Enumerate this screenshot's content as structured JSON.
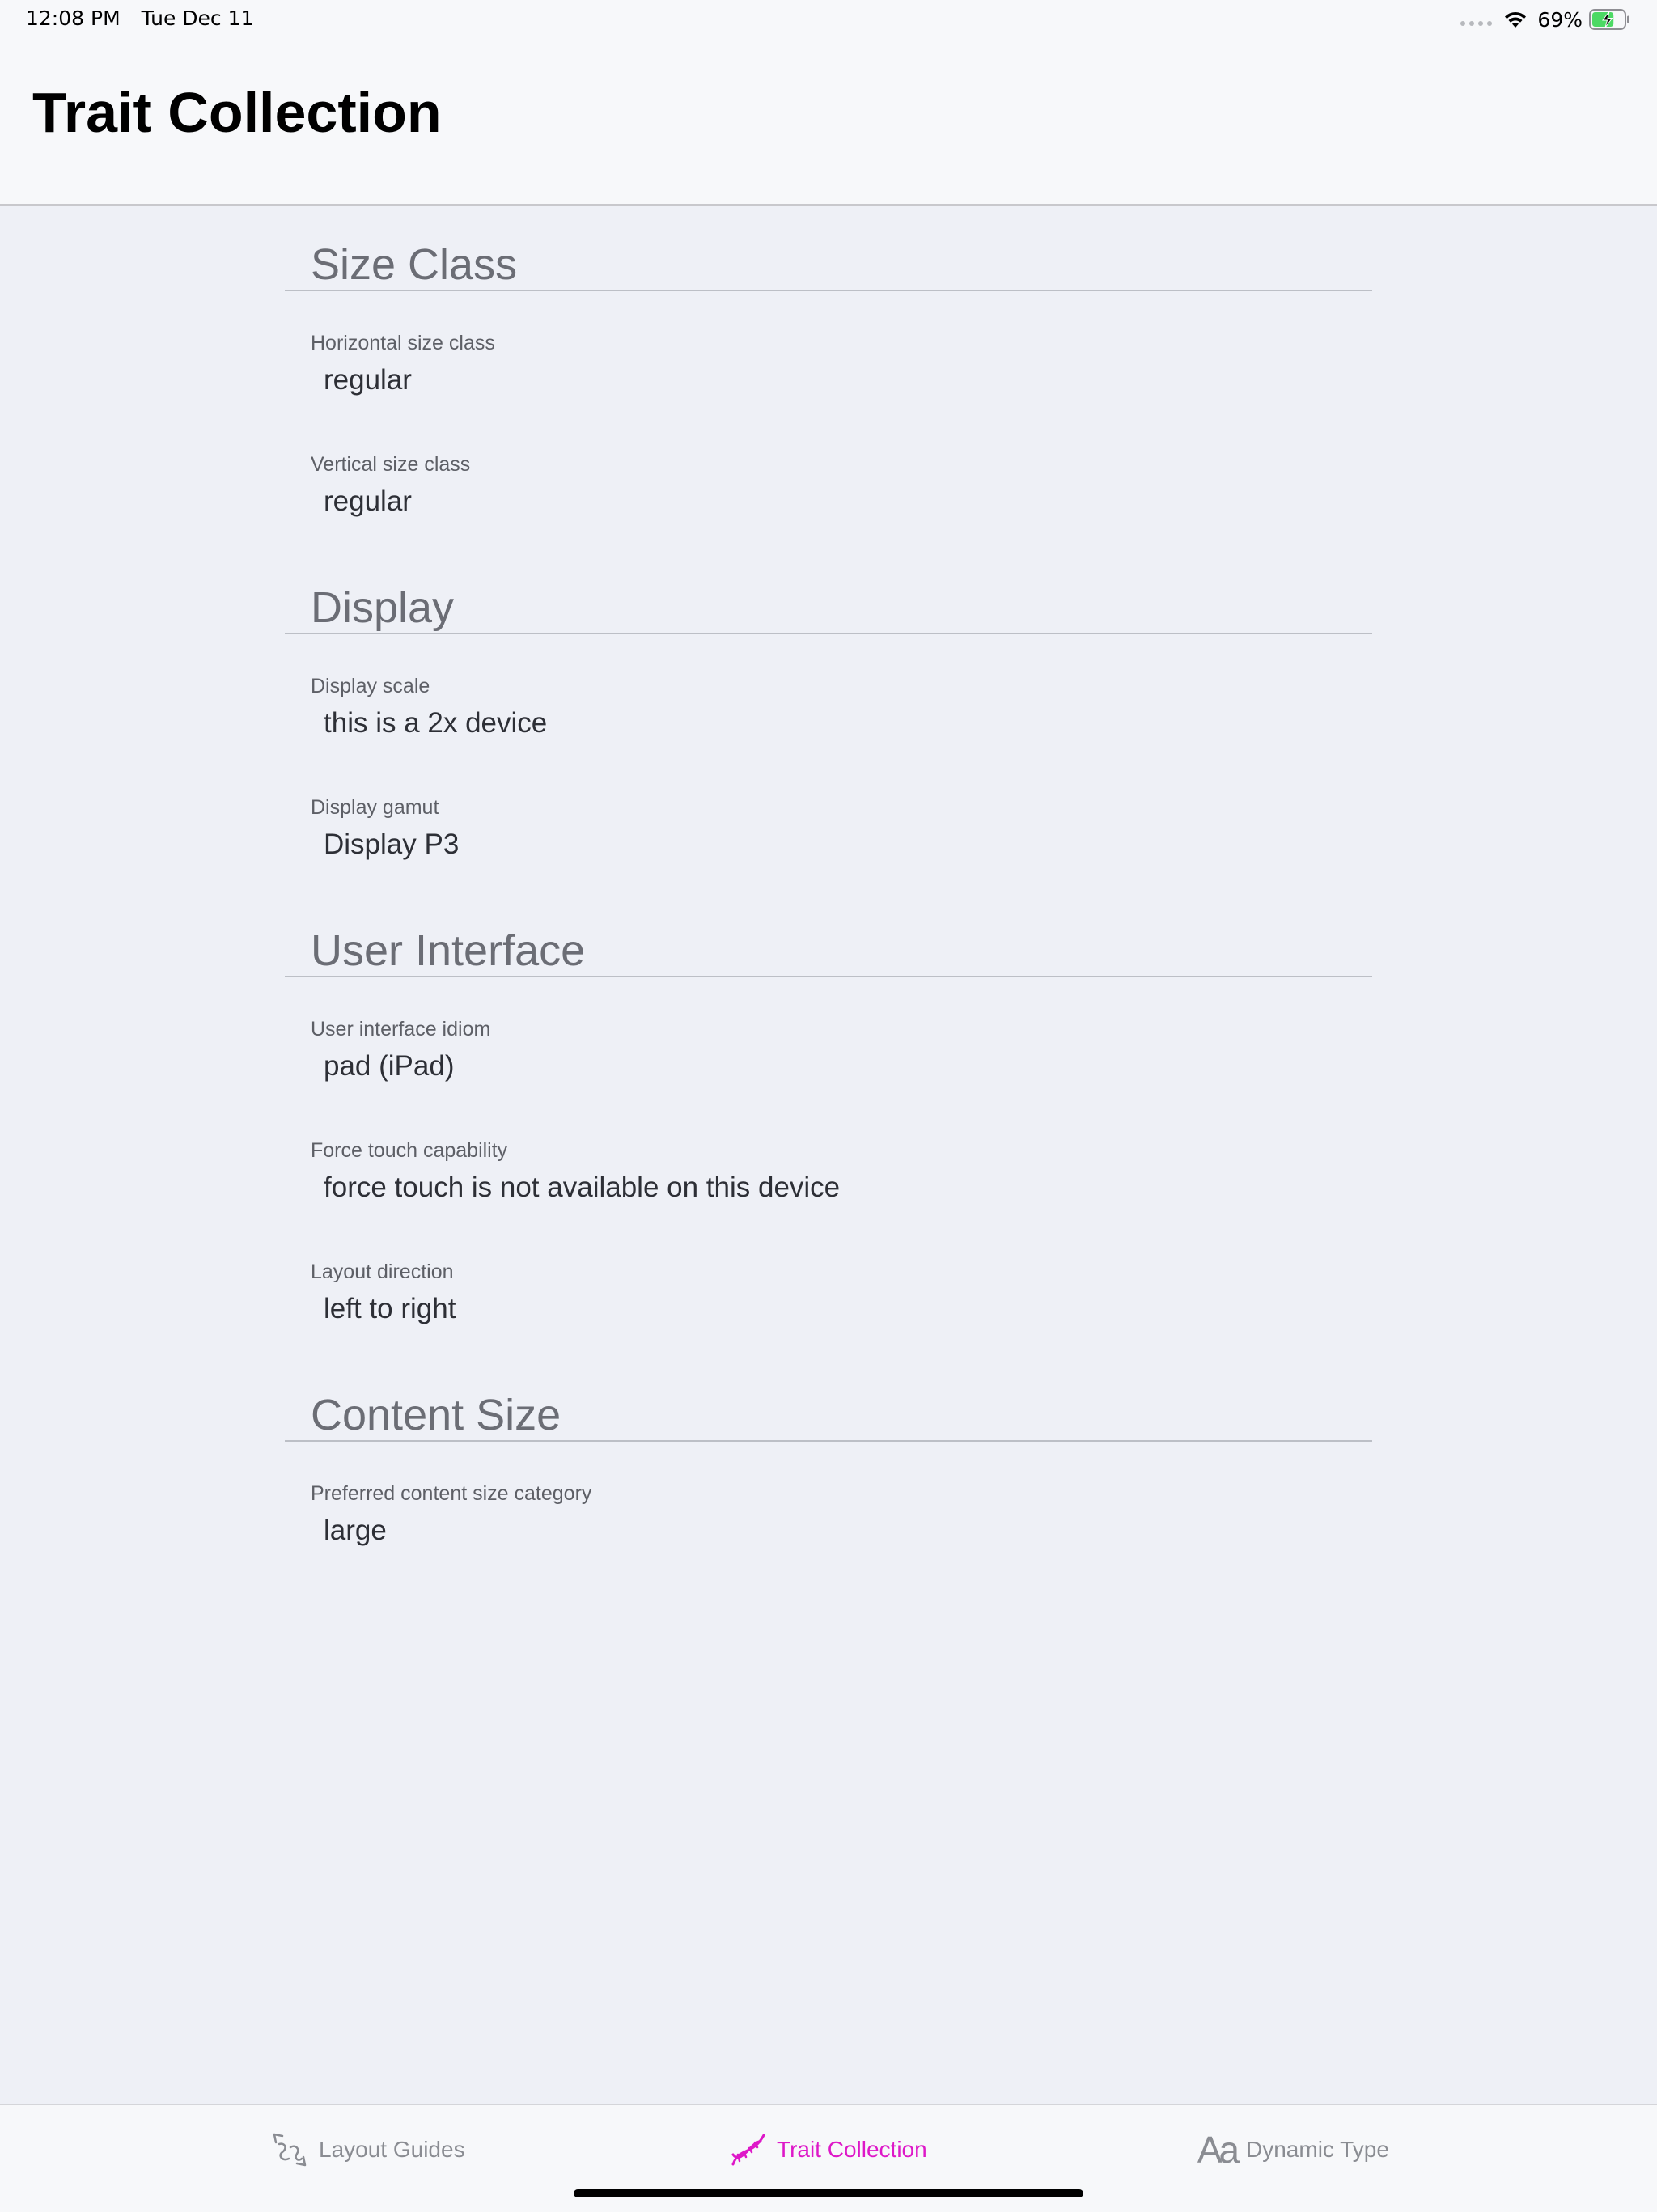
{
  "status_bar": {
    "time": "12:08 PM",
    "date": "Tue Dec 11",
    "battery_percent": "69%",
    "battery_level": 0.69,
    "icons": [
      "signal-dots-icon",
      "wifi-icon",
      "battery-charging-icon"
    ]
  },
  "nav": {
    "title": "Trait Collection"
  },
  "sections": [
    {
      "title": "Size Class",
      "traits": [
        {
          "label": "Horizontal size class",
          "value": "regular"
        },
        {
          "label": "Vertical size class",
          "value": "regular"
        }
      ]
    },
    {
      "title": "Display",
      "traits": [
        {
          "label": "Display scale",
          "value": "this is a 2x device"
        },
        {
          "label": "Display gamut",
          "value": "Display P3"
        }
      ]
    },
    {
      "title": "User Interface",
      "traits": [
        {
          "label": "User interface idiom",
          "value": "pad (iPad)"
        },
        {
          "label": "Force touch capability",
          "value": "force touch is not available on this device"
        },
        {
          "label": "Layout direction",
          "value": "left to right"
        }
      ]
    },
    {
      "title": "Content Size",
      "traits": [
        {
          "label": "Preferred content size category",
          "value": "large"
        }
      ]
    }
  ],
  "tab_bar": {
    "tabs": [
      {
        "label": "Layout Guides",
        "icon": "layout-guides-icon",
        "selected": false
      },
      {
        "label": "Trait Collection",
        "icon": "dna-icon",
        "selected": true
      },
      {
        "label": "Dynamic Type",
        "icon": "dynamic-type-icon",
        "icon_glyph": "Aa",
        "selected": false
      }
    ]
  },
  "colors": {
    "accent": "#de18c8",
    "background": "#eef0f6",
    "bar_background": "#f7f8fa",
    "section_title": "#6b6d75",
    "inactive_tab": "#8a8c92"
  }
}
